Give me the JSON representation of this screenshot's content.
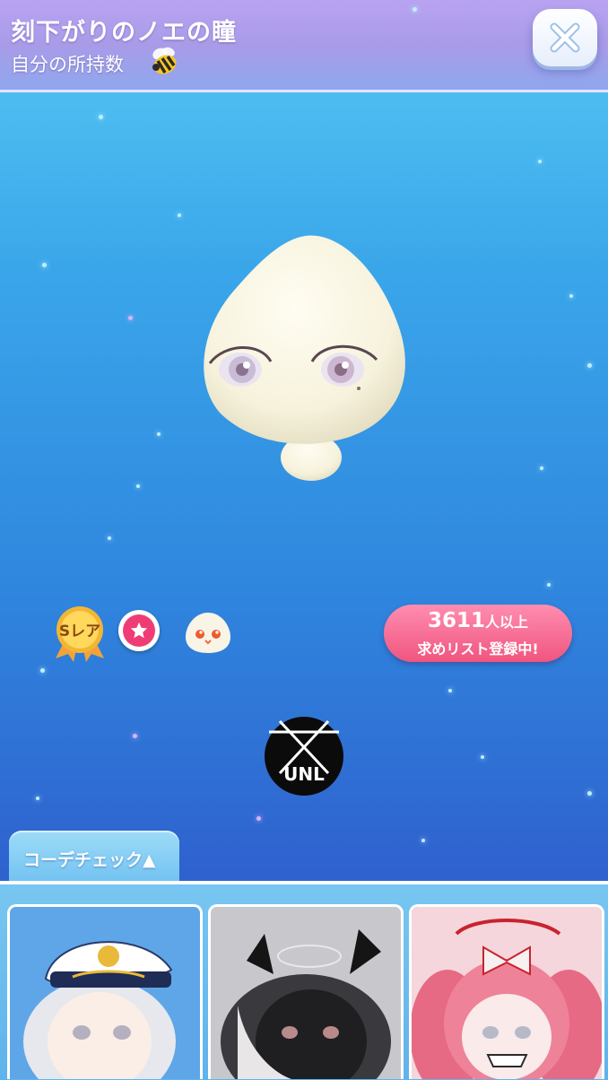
{
  "header": {
    "title": "刻下がりのノエの瞳",
    "subtitle": "自分の所持数",
    "bee_icon": "bee-icon",
    "close_icon": "close-icon"
  },
  "item": {
    "rarity_label": "Sレア",
    "favorite_icon": "star-icon",
    "wishlist_count": "3611",
    "wishlist_unit": "人以上",
    "wishlist_text": "求めリスト登録中!"
  },
  "coord_check": {
    "tab_label": "コーデチェック▲",
    "cards": [
      {
        "name": "sailor-captain-avatar"
      },
      {
        "name": "dark-horned-avatar"
      },
      {
        "name": "pink-twintail-avatar"
      }
    ]
  },
  "watermark": {
    "text": "UNL"
  },
  "colors": {
    "accent_pink": "#f0557f",
    "header_purple": "#a99be8",
    "background_blue": "#2f86de"
  }
}
